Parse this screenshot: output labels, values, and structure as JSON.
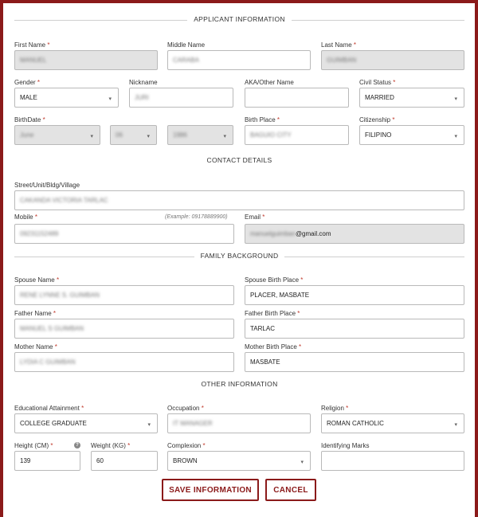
{
  "sections": {
    "applicant": "APPLICANT INFORMATION",
    "contact": "CONTACT DETAILS",
    "family": "FAMILY BACKGROUND",
    "other": "OTHER INFORMATION"
  },
  "applicant": {
    "first_name": {
      "label": "First Name",
      "value": "MANUEL"
    },
    "middle_name": {
      "label": "Middle Name",
      "value": "CARABA"
    },
    "last_name": {
      "label": "Last Name",
      "value": "GUIMBAN"
    },
    "gender": {
      "label": "Gender",
      "value": "MALE"
    },
    "nickname": {
      "label": "Nickname",
      "value": "JURI"
    },
    "aka": {
      "label": "AKA/Other Name",
      "value": ""
    },
    "civil_status": {
      "label": "Civil Status",
      "value": "MARRIED"
    },
    "birthdate": {
      "label": "BirthDate",
      "month": "June",
      "day": "06",
      "year": "1986"
    },
    "birth_place": {
      "label": "Birth Place",
      "value": "BAGUIO CITY"
    },
    "citizenship": {
      "label": "Citizenship",
      "value": "FILIPINO"
    }
  },
  "contact": {
    "street": {
      "label": "Street/Unit/Bldg/Village",
      "value": "CAKANDA VICTORIA TARLAC"
    },
    "mobile": {
      "label": "Mobile",
      "hint": "(Example: 09178889900)",
      "value": "09231152489"
    },
    "email": {
      "label": "Email",
      "value_hidden": "manuelguimban",
      "value_domain": "@gmail.com"
    }
  },
  "family": {
    "spouse_name": {
      "label": "Spouse Name",
      "value": "RENE LYNNE S. GUIMBAN"
    },
    "spouse_birth_place": {
      "label": "Spouse Birth Place",
      "value": "PLACER, MASBATE"
    },
    "father_name": {
      "label": "Father Name",
      "value": "MANUEL S GUIMBAN"
    },
    "father_birth_place": {
      "label": "Father Birth Place",
      "value": "TARLAC"
    },
    "mother_name": {
      "label": "Mother Name",
      "value": "LYDIA C GUIMBAN"
    },
    "mother_birth_place": {
      "label": "Mother Birth Place",
      "value": "MASBATE"
    }
  },
  "other": {
    "education": {
      "label": "Educational Attainment",
      "value": "COLLEGE GRADUATE"
    },
    "occupation": {
      "label": "Occupation",
      "value": "IT MANAGER"
    },
    "religion": {
      "label": "Religion",
      "value": "ROMAN CATHOLIC"
    },
    "height": {
      "label": "Height (CM)",
      "value": "139"
    },
    "weight": {
      "label": "Weight (KG)",
      "value": "60"
    },
    "complexion": {
      "label": "Complexion",
      "value": "BROWN"
    },
    "marks": {
      "label": "Identifying Marks",
      "value": ""
    }
  },
  "buttons": {
    "save": "SAVE INFORMATION",
    "cancel": "CANCEL"
  },
  "required_mark": "*",
  "icons": {
    "caret": "chevron-down-icon",
    "help": "question-circle-icon"
  },
  "colors": {
    "accent": "#8b1a1a",
    "required": "#c0392b"
  }
}
